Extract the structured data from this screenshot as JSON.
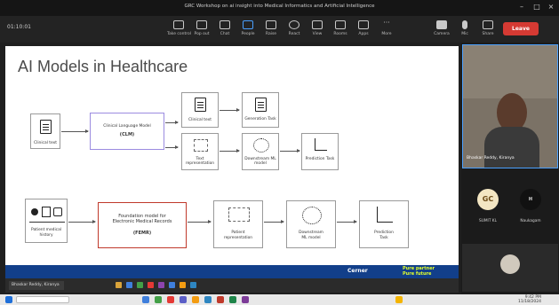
{
  "window": {
    "title": "GRC Workshop on ai insight into Medical Informatics and Artificial Intelligence"
  },
  "toolbar": {
    "left_label": "01:10:01",
    "items": [
      {
        "label": "Take control"
      },
      {
        "label": "Pop out"
      },
      {
        "label": "Chat"
      },
      {
        "label": "People"
      },
      {
        "label": "Raise"
      },
      {
        "label": "React"
      },
      {
        "label": "View"
      },
      {
        "label": "Rooms"
      },
      {
        "label": "Apps"
      },
      {
        "label": "More"
      },
      {
        "label": "Camera"
      },
      {
        "label": "Mic"
      },
      {
        "label": "Share"
      }
    ],
    "leave_label": "Leave"
  },
  "slide": {
    "title": "AI Models in Healthcare",
    "top_flow": {
      "clinical_text": "Clinical text",
      "clm_line1": "Clinical Language Model",
      "clm_line2": "(CLM)",
      "upper_input": "Clinical text",
      "upper_output": "Generation Task",
      "lower_input": "Text representation",
      "lower_model": "Downstream ML model",
      "lower_output": "Prediction Task"
    },
    "bottom_flow": {
      "history_line1": "Patient medical",
      "history_line2": "history",
      "fm_line1": "Foundation model for",
      "fm_line2": "Electronic Medical Records",
      "fm_line3": "(FEMR)",
      "representation_line1": "Patient",
      "representation_line2": "representation",
      "model_line1": "Downstream",
      "model_line2": "ML model",
      "task_line1": "Prediction",
      "task_line2": "Task"
    },
    "footer": {
      "logo": "Cerner",
      "tagline_line1": "Pure partner",
      "tagline_line2": "Pure future"
    }
  },
  "presenter_bar": {
    "name": "Bhaskar Reddy, Kiranya"
  },
  "participants": {
    "video_name": "Bhaskar Reddy, Kiranya",
    "tiles": [
      {
        "initials": "GC",
        "name": "SUMIT KL"
      },
      {
        "initials": "H",
        "name": "Naukagam"
      }
    ]
  },
  "taskbar": {
    "time": "9:42 PM",
    "date": "11/18/2024"
  },
  "colors": {
    "leave": "#d53a33",
    "footer": "#123f8a",
    "footer_tagline": "#e2ff2d",
    "clm_border": "#9b8be0",
    "fm_border": "#c0392b",
    "avatar_gc": "#f3e6c3",
    "avatar_h": "#111111"
  }
}
